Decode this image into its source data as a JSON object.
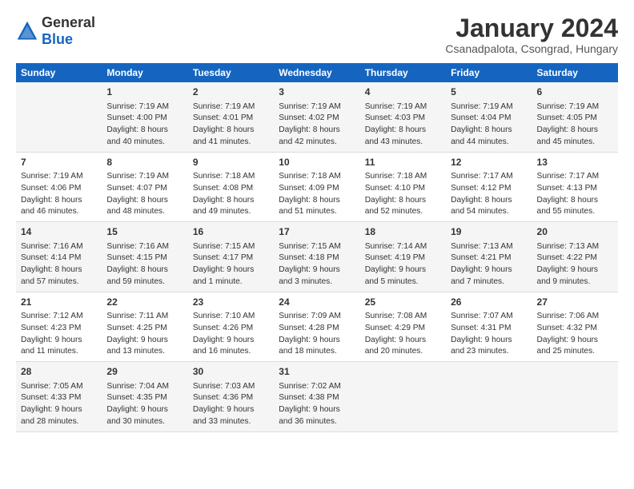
{
  "logo": {
    "general": "General",
    "blue": "Blue"
  },
  "title": "January 2024",
  "subtitle": "Csanadpalota, Csongrad, Hungary",
  "headers": [
    "Sunday",
    "Monday",
    "Tuesday",
    "Wednesday",
    "Thursday",
    "Friday",
    "Saturday"
  ],
  "weeks": [
    [
      {
        "day": "",
        "content": ""
      },
      {
        "day": "1",
        "content": "Sunrise: 7:19 AM\nSunset: 4:00 PM\nDaylight: 8 hours\nand 40 minutes."
      },
      {
        "day": "2",
        "content": "Sunrise: 7:19 AM\nSunset: 4:01 PM\nDaylight: 8 hours\nand 41 minutes."
      },
      {
        "day": "3",
        "content": "Sunrise: 7:19 AM\nSunset: 4:02 PM\nDaylight: 8 hours\nand 42 minutes."
      },
      {
        "day": "4",
        "content": "Sunrise: 7:19 AM\nSunset: 4:03 PM\nDaylight: 8 hours\nand 43 minutes."
      },
      {
        "day": "5",
        "content": "Sunrise: 7:19 AM\nSunset: 4:04 PM\nDaylight: 8 hours\nand 44 minutes."
      },
      {
        "day": "6",
        "content": "Sunrise: 7:19 AM\nSunset: 4:05 PM\nDaylight: 8 hours\nand 45 minutes."
      }
    ],
    [
      {
        "day": "7",
        "content": "Sunrise: 7:19 AM\nSunset: 4:06 PM\nDaylight: 8 hours\nand 46 minutes."
      },
      {
        "day": "8",
        "content": "Sunrise: 7:19 AM\nSunset: 4:07 PM\nDaylight: 8 hours\nand 48 minutes."
      },
      {
        "day": "9",
        "content": "Sunrise: 7:18 AM\nSunset: 4:08 PM\nDaylight: 8 hours\nand 49 minutes."
      },
      {
        "day": "10",
        "content": "Sunrise: 7:18 AM\nSunset: 4:09 PM\nDaylight: 8 hours\nand 51 minutes."
      },
      {
        "day": "11",
        "content": "Sunrise: 7:18 AM\nSunset: 4:10 PM\nDaylight: 8 hours\nand 52 minutes."
      },
      {
        "day": "12",
        "content": "Sunrise: 7:17 AM\nSunset: 4:12 PM\nDaylight: 8 hours\nand 54 minutes."
      },
      {
        "day": "13",
        "content": "Sunrise: 7:17 AM\nSunset: 4:13 PM\nDaylight: 8 hours\nand 55 minutes."
      }
    ],
    [
      {
        "day": "14",
        "content": "Sunrise: 7:16 AM\nSunset: 4:14 PM\nDaylight: 8 hours\nand 57 minutes."
      },
      {
        "day": "15",
        "content": "Sunrise: 7:16 AM\nSunset: 4:15 PM\nDaylight: 8 hours\nand 59 minutes."
      },
      {
        "day": "16",
        "content": "Sunrise: 7:15 AM\nSunset: 4:17 PM\nDaylight: 9 hours\nand 1 minute."
      },
      {
        "day": "17",
        "content": "Sunrise: 7:15 AM\nSunset: 4:18 PM\nDaylight: 9 hours\nand 3 minutes."
      },
      {
        "day": "18",
        "content": "Sunrise: 7:14 AM\nSunset: 4:19 PM\nDaylight: 9 hours\nand 5 minutes."
      },
      {
        "day": "19",
        "content": "Sunrise: 7:13 AM\nSunset: 4:21 PM\nDaylight: 9 hours\nand 7 minutes."
      },
      {
        "day": "20",
        "content": "Sunrise: 7:13 AM\nSunset: 4:22 PM\nDaylight: 9 hours\nand 9 minutes."
      }
    ],
    [
      {
        "day": "21",
        "content": "Sunrise: 7:12 AM\nSunset: 4:23 PM\nDaylight: 9 hours\nand 11 minutes."
      },
      {
        "day": "22",
        "content": "Sunrise: 7:11 AM\nSunset: 4:25 PM\nDaylight: 9 hours\nand 13 minutes."
      },
      {
        "day": "23",
        "content": "Sunrise: 7:10 AM\nSunset: 4:26 PM\nDaylight: 9 hours\nand 16 minutes."
      },
      {
        "day": "24",
        "content": "Sunrise: 7:09 AM\nSunset: 4:28 PM\nDaylight: 9 hours\nand 18 minutes."
      },
      {
        "day": "25",
        "content": "Sunrise: 7:08 AM\nSunset: 4:29 PM\nDaylight: 9 hours\nand 20 minutes."
      },
      {
        "day": "26",
        "content": "Sunrise: 7:07 AM\nSunset: 4:31 PM\nDaylight: 9 hours\nand 23 minutes."
      },
      {
        "day": "27",
        "content": "Sunrise: 7:06 AM\nSunset: 4:32 PM\nDaylight: 9 hours\nand 25 minutes."
      }
    ],
    [
      {
        "day": "28",
        "content": "Sunrise: 7:05 AM\nSunset: 4:33 PM\nDaylight: 9 hours\nand 28 minutes."
      },
      {
        "day": "29",
        "content": "Sunrise: 7:04 AM\nSunset: 4:35 PM\nDaylight: 9 hours\nand 30 minutes."
      },
      {
        "day": "30",
        "content": "Sunrise: 7:03 AM\nSunset: 4:36 PM\nDaylight: 9 hours\nand 33 minutes."
      },
      {
        "day": "31",
        "content": "Sunrise: 7:02 AM\nSunset: 4:38 PM\nDaylight: 9 hours\nand 36 minutes."
      },
      {
        "day": "",
        "content": ""
      },
      {
        "day": "",
        "content": ""
      },
      {
        "day": "",
        "content": ""
      }
    ]
  ]
}
